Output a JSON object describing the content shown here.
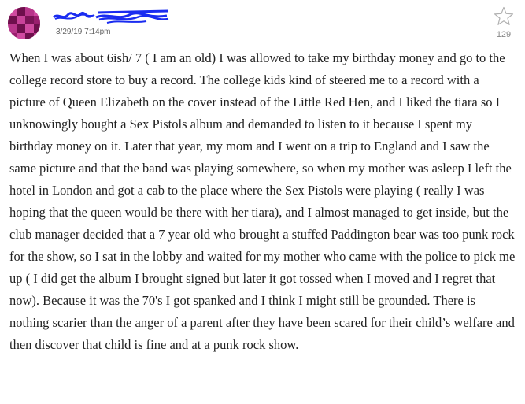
{
  "post": {
    "timestamp": "3/29/19 7:14pm",
    "vote_count": "129",
    "body": "When I was about 6ish/ 7 ( I am an old) I was allowed to take my birthday money and go to the college record store to buy a record. The college kids kind of steered me to a record with a picture of Queen Elizabeth on the cover instead of the Little Red Hen, and I liked the tiara so I unknowingly bought a Sex Pistols album and demanded to listen to it because I spent my birthday money on it. Later that year, my mom and I went on a trip to England and I saw the same picture and that the band was playing somewhere, so when my mother was asleep I left the hotel in London and got a cab to the place where the Sex Pistols were playing ( really I was hoping that the queen would be there with her tiara), and I almost managed to get inside, but the club manager decided that a 7 year old who brought a stuffed Paddington bear was too punk rock for the show, so I sat in the lobby and waited for my mother who came with the police to pick me up ( I did get the album I brought signed but later it got tossed when I moved and I regret that now). Because it was the 70's I got spanked and I think I might still be grounded. There is nothing scarier than the anger of a parent after they have been scared for their child’s welfare and then discover that child is fine and at a punk rock show."
  },
  "icons": {
    "avatar": "pixel-identicon-avatar",
    "username": "redacted-username-scribble",
    "star": "star-outline-icon"
  },
  "colors": {
    "avatar_base": "#9a1e6e",
    "avatar_light": "#d04aa0",
    "avatar_dark": "#6e0f4c",
    "redaction": "#1a2cf0",
    "star": "#b0b0b0"
  }
}
